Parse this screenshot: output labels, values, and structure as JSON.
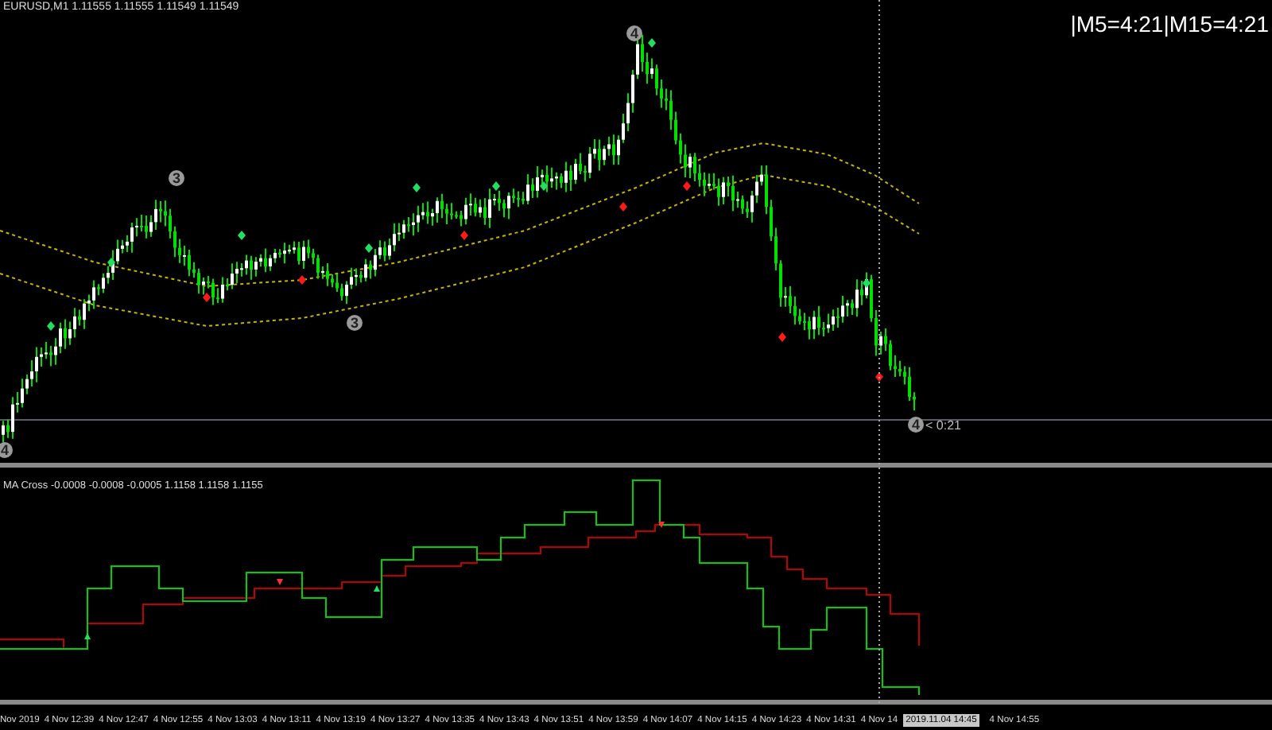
{
  "chart": {
    "symbol_header": "EURUSD,M1  1.11555 1.11555 1.11549 1.11549",
    "timer": "|M5=4:21|M15=4:21",
    "price_tag": "< 0:21",
    "wave_labels": [
      {
        "text": "4"
      },
      {
        "text": "3"
      },
      {
        "text": "3"
      },
      {
        "text": "4"
      },
      {
        "text": "4"
      }
    ]
  },
  "indicator": {
    "title": "MA Cross -0.0008 -0.0008 -0.0005   1.1158 1.1158 1.1155"
  },
  "time_axis": [
    {
      "label": "Nov 2019",
      "kind": "tick"
    },
    {
      "label": "4 Nov 12:39",
      "kind": "tick"
    },
    {
      "label": "4 Nov 12:47",
      "kind": "tick"
    },
    {
      "label": "4 Nov 12:55",
      "kind": "tick"
    },
    {
      "label": "4 Nov 13:03",
      "kind": "tick"
    },
    {
      "label": "4 Nov 13:11",
      "kind": "tick"
    },
    {
      "label": "4 Nov 13:19",
      "kind": "tick"
    },
    {
      "label": "4 Nov 13:27",
      "kind": "tick"
    },
    {
      "label": "4 Nov 13:35",
      "kind": "tick"
    },
    {
      "label": "4 Nov 13:43",
      "kind": "tick"
    },
    {
      "label": "4 Nov 13:51",
      "kind": "tick"
    },
    {
      "label": "4 Nov 13:59",
      "kind": "tick"
    },
    {
      "label": "4 Nov 14:07",
      "kind": "tick"
    },
    {
      "label": "4 Nov 14:15",
      "kind": "tick"
    },
    {
      "label": "4 Nov 14:23",
      "kind": "tick"
    },
    {
      "label": "4 Nov 14:31",
      "kind": "tick"
    },
    {
      "label": "4 Nov 14",
      "kind": "tick"
    },
    {
      "label": "2019.11.04 14:45",
      "kind": "cursor"
    },
    {
      "label": "4 Nov 14:55",
      "kind": "tick"
    }
  ]
}
